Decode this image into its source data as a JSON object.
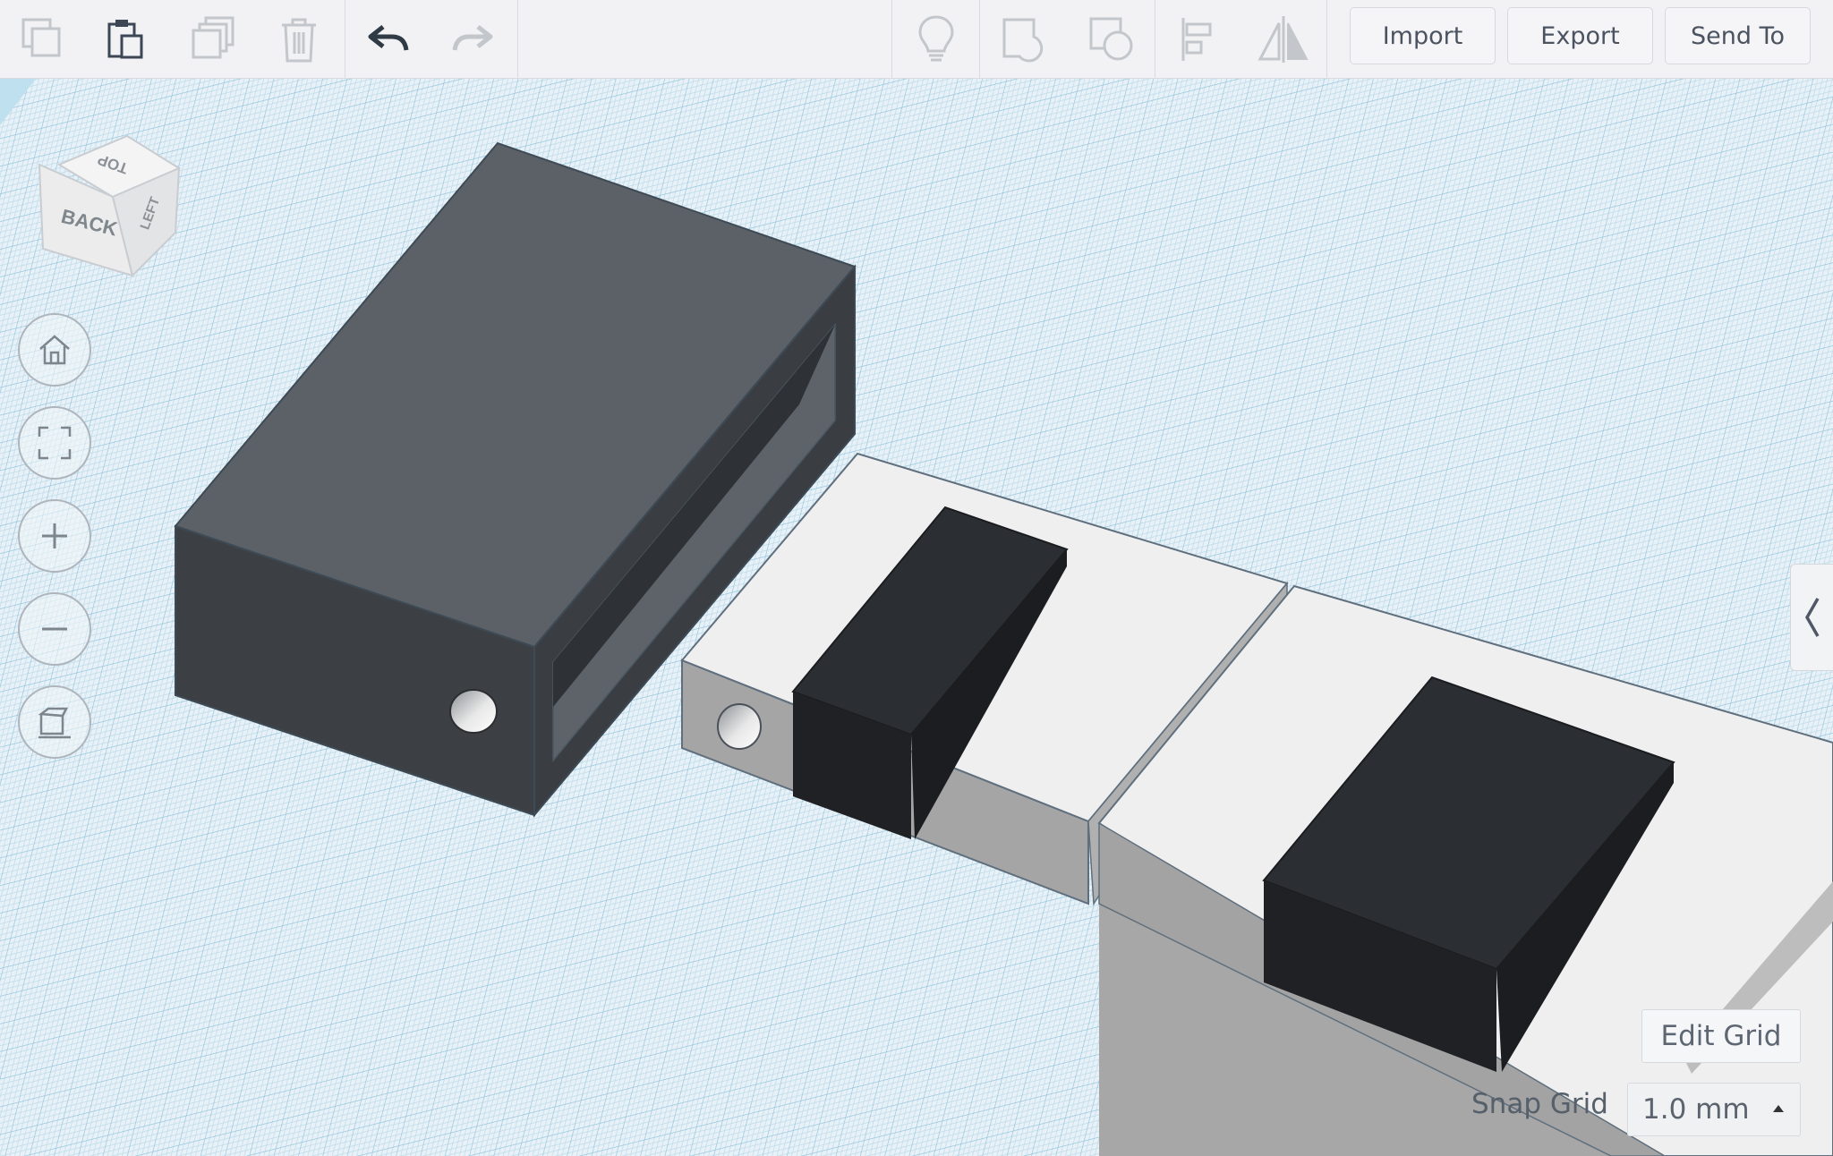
{
  "toolbar": {
    "copy_icon": "copy-icon",
    "paste_icon": "paste-icon",
    "duplicate_icon": "duplicate-icon",
    "delete_icon": "trash-icon",
    "undo_icon": "undo-icon",
    "redo_icon": "redo-icon",
    "lightbulb_icon": "lightbulb-icon",
    "group_icon": "group-icon",
    "ungroup_icon": "ungroup-icon",
    "align_icon": "align-icon",
    "mirror_icon": "mirror-icon",
    "import_label": "Import",
    "export_label": "Export",
    "sendto_label": "Send To"
  },
  "viewcube": {
    "top_label": "TOP",
    "back_label": "BACK",
    "side_label": "LEFT"
  },
  "nav": {
    "home_icon": "home-icon",
    "fit_icon": "fit-view-icon",
    "zoom_in_icon": "zoom-in-icon",
    "zoom_out_icon": "zoom-out-icon",
    "perspective_icon": "perspective-icon"
  },
  "panel_toggle_icon": "chevron-left-icon",
  "grid": {
    "edit_label": "Edit Grid",
    "snap_label": "Snap Grid",
    "snap_value": "1.0 mm"
  },
  "colors": {
    "grid_bg": "#e8f2f7",
    "dark_shape": "#2b2f33",
    "gray_shape": "#5b6166",
    "white_shape": "#efeff0"
  }
}
